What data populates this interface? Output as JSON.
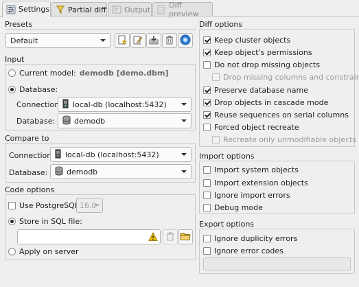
{
  "tabs": [
    {
      "label": "Settings",
      "icon": "settings-icon",
      "active": true
    },
    {
      "label": "Partial diff",
      "icon": "partial-diff-icon",
      "active": false
    },
    {
      "label": "Output",
      "icon": "output-icon",
      "active": false
    },
    {
      "label": "Diff preview",
      "icon": "diff-preview-icon",
      "active": false
    }
  ],
  "presets": {
    "title": "Presets",
    "selected": "Default",
    "buttons": [
      "new-preset-icon",
      "edit-preset-icon",
      "save-preset-icon",
      "delete-preset-icon",
      "default-preset-icon"
    ]
  },
  "input": {
    "title": "Input",
    "current_model_label": "Current model:",
    "current_model_value": "demodb [demo.dbm]",
    "database_radio_label": "Database:",
    "connection_label": "Connection:",
    "connection_value": "local-db (localhost:5432)",
    "database_label": "Database:",
    "database_value": "demodb"
  },
  "compare_to": {
    "title": "Compare to",
    "connection_label": "Connection:",
    "connection_value": "local-db (localhost:5432)",
    "database_label": "Database:",
    "database_value": "demodb"
  },
  "code_options": {
    "title": "Code options",
    "use_pg_label": "Use PostgreSQL:",
    "pg_version": "16.0",
    "store_sql_label": "Store in SQL file:",
    "sql_file_value": "",
    "apply_server_label": "Apply on server"
  },
  "diff_options": {
    "title": "Diff options",
    "items": [
      {
        "label": "Keep cluster objects",
        "checked": true,
        "disabled": false,
        "indent": false
      },
      {
        "label": "Keep object's permissions",
        "checked": true,
        "disabled": false,
        "indent": false
      },
      {
        "label": "Do not drop missing objects",
        "checked": false,
        "disabled": false,
        "indent": false
      },
      {
        "label": "Drop missing columns and constraints",
        "checked": false,
        "disabled": true,
        "indent": true
      },
      {
        "label": "Preserve database name",
        "checked": true,
        "disabled": false,
        "indent": false
      },
      {
        "label": "Drop objects in cascade mode",
        "checked": true,
        "disabled": false,
        "indent": false
      },
      {
        "label": "Reuse sequences on serial columns",
        "checked": true,
        "disabled": false,
        "indent": false
      },
      {
        "label": "Forced object recreate",
        "checked": false,
        "disabled": false,
        "indent": false
      },
      {
        "label": "Recreate only unmodifiable objects",
        "checked": false,
        "disabled": true,
        "indent": true
      }
    ]
  },
  "import_options": {
    "title": "Import options",
    "items": [
      {
        "label": "Import system objects",
        "checked": false
      },
      {
        "label": "Import extension objects",
        "checked": false
      },
      {
        "label": "Ignore import errors",
        "checked": false
      },
      {
        "label": "Debug mode",
        "checked": false
      }
    ]
  },
  "export_options": {
    "title": "Export options",
    "items": [
      {
        "label": "Ignore duplicity errors",
        "checked": false
      },
      {
        "label": "Ignore error codes",
        "checked": false
      }
    ],
    "error_codes_value": ""
  },
  "colors": {
    "warning": "#e6b800",
    "folder": "#e8b83a",
    "default_preset": "#2b7bd6"
  }
}
